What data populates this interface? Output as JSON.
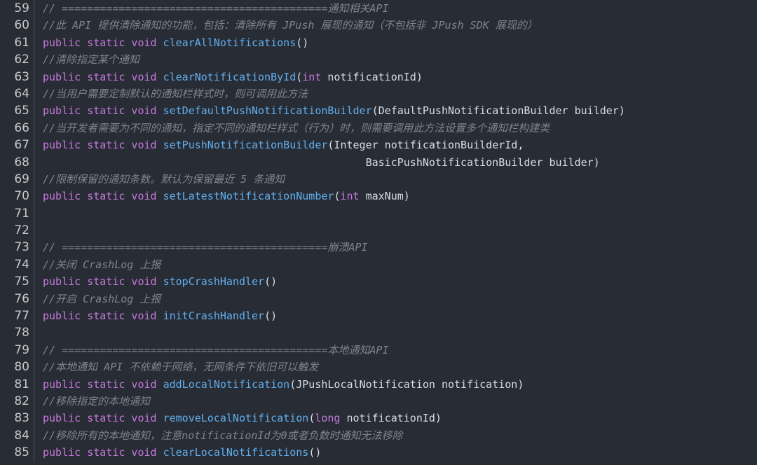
{
  "colors": {
    "background": "#282c34",
    "keyword": "#c678dd",
    "function": "#61afef",
    "plain": "#d8dee9",
    "comment": "#7f848e",
    "line_number": "#c8c8c8"
  },
  "lines": [
    {
      "number": "59",
      "tokens": [
        {
          "t": "comment",
          "v": "// ==========================================通知相关API"
        }
      ]
    },
    {
      "number": "60",
      "tokens": [
        {
          "t": "comment",
          "v": "//此 API 提供清除通知的功能，包括：清除所有 JPush 展现的通知（不包括非 JPush SDK 展现的）"
        }
      ]
    },
    {
      "number": "61",
      "tokens": [
        {
          "t": "kw",
          "v": "public static void "
        },
        {
          "t": "fn",
          "v": "clearAllNotifications"
        },
        {
          "t": "plain",
          "v": "()"
        }
      ]
    },
    {
      "number": "62",
      "tokens": [
        {
          "t": "comment",
          "v": "//清除指定某个通知"
        }
      ]
    },
    {
      "number": "63",
      "tokens": [
        {
          "t": "kw",
          "v": "public static void "
        },
        {
          "t": "fn",
          "v": "clearNotificationById"
        },
        {
          "t": "plain",
          "v": "("
        },
        {
          "t": "kw",
          "v": "int"
        },
        {
          "t": "plain",
          "v": " notificationId)"
        }
      ]
    },
    {
      "number": "64",
      "tokens": [
        {
          "t": "comment",
          "v": "//当用户需要定制默认的通知栏样式时，则可调用此方法"
        }
      ]
    },
    {
      "number": "65",
      "tokens": [
        {
          "t": "kw",
          "v": "public static void "
        },
        {
          "t": "fn",
          "v": "setDefaultPushNotificationBuilder"
        },
        {
          "t": "plain",
          "v": "(DefaultPushNotificationBuilder builder)"
        }
      ]
    },
    {
      "number": "66",
      "tokens": [
        {
          "t": "comment",
          "v": "//当开发者需要为不同的通知，指定不同的通知栏样式（行为）时，则需要调用此方法设置多个通知栏构建类"
        }
      ]
    },
    {
      "number": "67",
      "tokens": [
        {
          "t": "kw",
          "v": "public static void "
        },
        {
          "t": "fn",
          "v": "setPushNotificationBuilder"
        },
        {
          "t": "plain",
          "v": "(Integer notificationBuilderId,"
        }
      ]
    },
    {
      "number": "68",
      "tokens": [
        {
          "t": "plain",
          "v": "                                                   BasicPushNotificationBuilder builder)"
        }
      ]
    },
    {
      "number": "69",
      "tokens": [
        {
          "t": "comment",
          "v": "//限制保留的通知条数。默认为保留最近 5 条通知"
        }
      ]
    },
    {
      "number": "70",
      "tokens": [
        {
          "t": "kw",
          "v": "public static void "
        },
        {
          "t": "fn",
          "v": "setLatestNotificationNumber"
        },
        {
          "t": "plain",
          "v": "("
        },
        {
          "t": "kw",
          "v": "int"
        },
        {
          "t": "plain",
          "v": " maxNum)"
        }
      ]
    },
    {
      "number": "71",
      "tokens": []
    },
    {
      "number": "72",
      "tokens": []
    },
    {
      "number": "73",
      "tokens": [
        {
          "t": "comment",
          "v": "// ==========================================崩溃API"
        }
      ]
    },
    {
      "number": "74",
      "tokens": [
        {
          "t": "comment",
          "v": "//关闭 CrashLog 上报"
        }
      ]
    },
    {
      "number": "75",
      "tokens": [
        {
          "t": "kw",
          "v": "public static void "
        },
        {
          "t": "fn",
          "v": "stopCrashHandler"
        },
        {
          "t": "plain",
          "v": "()"
        }
      ]
    },
    {
      "number": "76",
      "tokens": [
        {
          "t": "comment",
          "v": "//开启 CrashLog 上报"
        }
      ]
    },
    {
      "number": "77",
      "tokens": [
        {
          "t": "kw",
          "v": "public static void "
        },
        {
          "t": "fn",
          "v": "initCrashHandler"
        },
        {
          "t": "plain",
          "v": "()"
        }
      ]
    },
    {
      "number": "78",
      "tokens": []
    },
    {
      "number": "79",
      "tokens": [
        {
          "t": "comment",
          "v": "// ==========================================本地通知API"
        }
      ]
    },
    {
      "number": "80",
      "tokens": [
        {
          "t": "comment",
          "v": "//本地通知 API 不依赖于网络，无网条件下依旧可以触发"
        }
      ]
    },
    {
      "number": "81",
      "tokens": [
        {
          "t": "kw",
          "v": "public static void "
        },
        {
          "t": "fn",
          "v": "addLocalNotification"
        },
        {
          "t": "plain",
          "v": "(JPushLocalNotification notification)"
        }
      ]
    },
    {
      "number": "82",
      "tokens": [
        {
          "t": "comment",
          "v": "//移除指定的本地通知"
        }
      ]
    },
    {
      "number": "83",
      "tokens": [
        {
          "t": "kw",
          "v": "public static void "
        },
        {
          "t": "fn",
          "v": "removeLocalNotification"
        },
        {
          "t": "plain",
          "v": "("
        },
        {
          "t": "kw",
          "v": "long"
        },
        {
          "t": "plain",
          "v": " notificationId)"
        }
      ]
    },
    {
      "number": "84",
      "tokens": [
        {
          "t": "comment",
          "v": "//移除所有的本地通知，注意notificationId为0或者负数时通知无法移除"
        }
      ]
    },
    {
      "number": "85",
      "tokens": [
        {
          "t": "kw",
          "v": "public static void "
        },
        {
          "t": "fn",
          "v": "clearLocalNotifications"
        },
        {
          "t": "plain",
          "v": "()"
        }
      ]
    }
  ]
}
